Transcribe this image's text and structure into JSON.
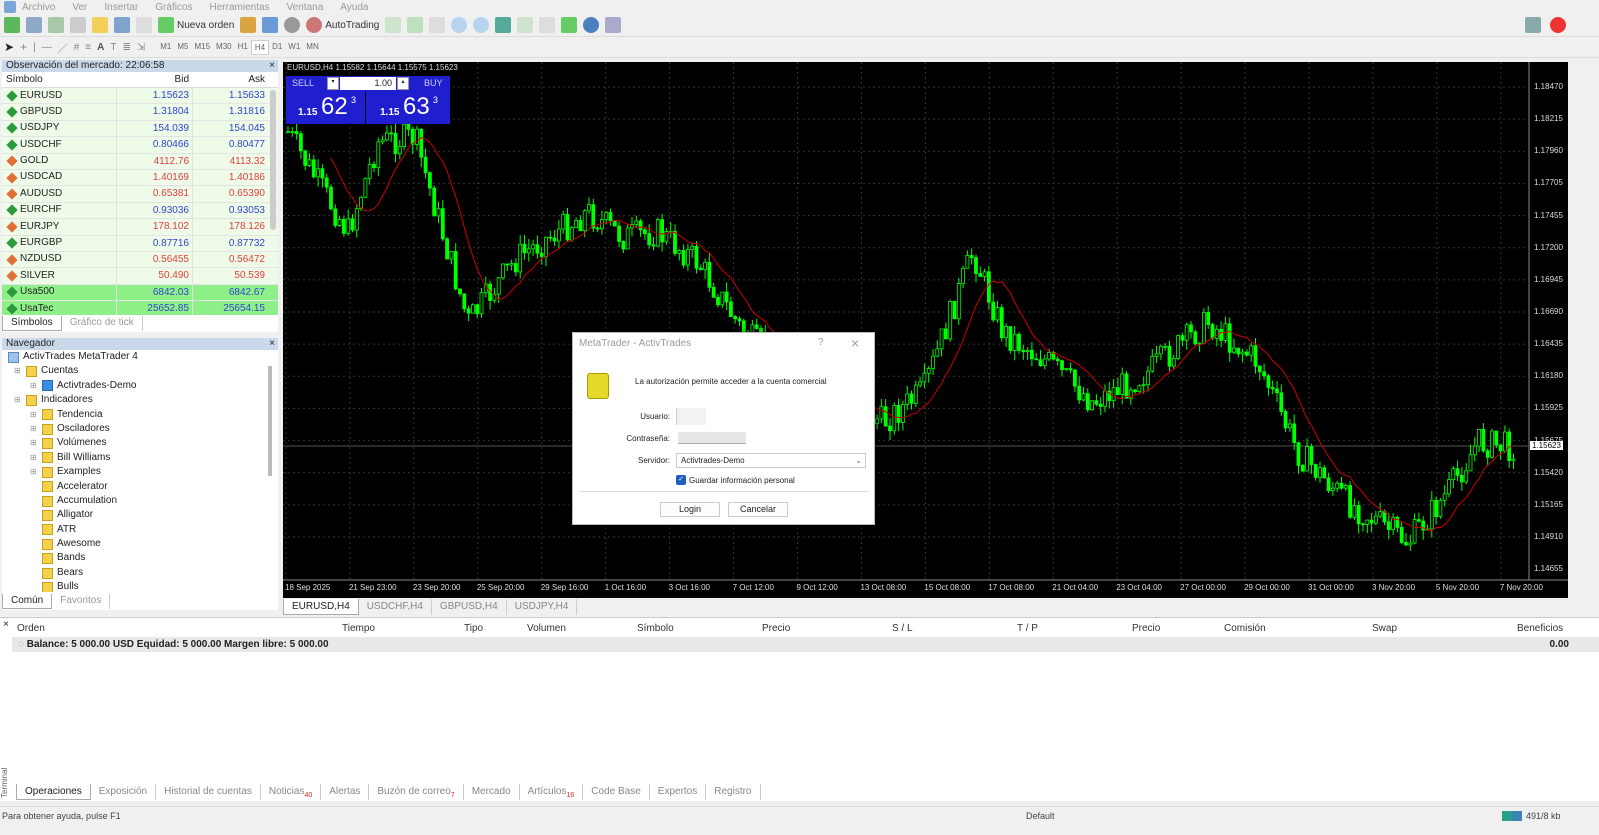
{
  "menu": [
    "Archivo",
    "Ver",
    "Insertar",
    "Gráficos",
    "Herramientas",
    "Ventana",
    "Ayuda"
  ],
  "toolbar": {
    "new_order": "Nueva orden",
    "autotrading": "AutoTrading",
    "timeframes": [
      "M1",
      "M5",
      "M15",
      "M30",
      "H1",
      "H4",
      "D1",
      "W1",
      "MN"
    ],
    "active_timeframe": "H4"
  },
  "market_watch": {
    "title": "Observación del mercado: 22:06:58",
    "columns": [
      "Símbolo",
      "Bid",
      "Ask"
    ],
    "rows": [
      {
        "symbol": "EURUSD",
        "bid": "1.15623",
        "ask": "1.15633",
        "dir": "up"
      },
      {
        "symbol": "GBPUSD",
        "bid": "1.31804",
        "ask": "1.31816",
        "dir": "up"
      },
      {
        "symbol": "USDJPY",
        "bid": "154.039",
        "ask": "154.045",
        "dir": "up"
      },
      {
        "symbol": "USDCHF",
        "bid": "0.80466",
        "ask": "0.80477",
        "dir": "up"
      },
      {
        "symbol": "GOLD",
        "bid": "4112.76",
        "ask": "4113.32",
        "dir": "dn"
      },
      {
        "symbol": "USDCAD",
        "bid": "1.40169",
        "ask": "1.40186",
        "dir": "dn"
      },
      {
        "symbol": "AUDUSD",
        "bid": "0.65381",
        "ask": "0.65390",
        "dir": "dn"
      },
      {
        "symbol": "EURCHF",
        "bid": "0.93036",
        "ask": "0.93053",
        "dir": "up"
      },
      {
        "symbol": "EURJPY",
        "bid": "178.102",
        "ask": "178.126",
        "dir": "dn"
      },
      {
        "symbol": "EURGBP",
        "bid": "0.87716",
        "ask": "0.87732",
        "dir": "up"
      },
      {
        "symbol": "NZDUSD",
        "bid": "0.56455",
        "ask": "0.56472",
        "dir": "dn"
      },
      {
        "symbol": "SILVER",
        "bid": "50.490",
        "ask": "50.539",
        "dir": "dn"
      },
      {
        "symbol": "Usa500",
        "bid": "6842.03",
        "ask": "6842.67",
        "dir": "up",
        "highlight": true
      },
      {
        "symbol": "UsaTec",
        "bid": "25652.85",
        "ask": "25654.15",
        "dir": "up",
        "highlight": true
      }
    ],
    "tabs": [
      "Símbolos",
      "Gráfico de tick"
    ]
  },
  "navigator": {
    "title": "Navegador",
    "root": "ActivTrades MetaTrader 4",
    "items": [
      {
        "label": "Cuentas",
        "level": 1
      },
      {
        "label": "Activtrades-Demo",
        "level": 2
      },
      {
        "label": "Indicadores",
        "level": 1
      },
      {
        "label": "Tendencia",
        "level": 2
      },
      {
        "label": "Osciladores",
        "level": 2
      },
      {
        "label": "Volúmenes",
        "level": 2
      },
      {
        "label": "Bill Williams",
        "level": 2
      },
      {
        "label": "Examples",
        "level": 2
      },
      {
        "label": "Accelerator",
        "level": 2
      },
      {
        "label": "Accumulation",
        "level": 2
      },
      {
        "label": "Alligator",
        "level": 2
      },
      {
        "label": "ATR",
        "level": 2
      },
      {
        "label": "Awesome",
        "level": 2
      },
      {
        "label": "Bands",
        "level": 2
      },
      {
        "label": "Bears",
        "level": 2
      },
      {
        "label": "Bulls",
        "level": 2
      }
    ],
    "tabs": [
      "Común",
      "Favoritos"
    ]
  },
  "chart": {
    "header": "EURUSD,H4  1.15582 1.15644 1.15575 1.15623",
    "one_click": {
      "sell": "SELL",
      "buy": "BUY",
      "lot": "1.00",
      "sell_prefix": "1.15",
      "sell_big": "62",
      "sell_sup": "3",
      "buy_prefix": "1.15",
      "buy_big": "63",
      "buy_sup": "3"
    },
    "price_ticks": [
      "1.18470",
      "1.18215",
      "1.17960",
      "1.17705",
      "1.17455",
      "1.17200",
      "1.16945",
      "1.16690",
      "1.16435",
      "1.16180",
      "1.15925",
      "1.15675",
      "1.15420",
      "1.15165",
      "1.14910",
      "1.14655"
    ],
    "current_price": "1.15623",
    "time_ticks": [
      "18 Sep 2025",
      "21 Sep 23:00",
      "23 Sep 20:00",
      "25 Sep 20:00",
      "29 Sep 16:00",
      "1 Oct 16:00",
      "3 Oct 16:00",
      "7 Oct 12:00",
      "9 Oct 12:00",
      "13 Oct 08:00",
      "15 Oct 08:00",
      "17 Oct 08:00",
      "21 Oct 04:00",
      "23 Oct 04:00",
      "27 Oct 00:00",
      "29 Oct 00:00",
      "31 Oct 00:00",
      "3 Nov 20:00",
      "5 Nov 20:00",
      "7 Nov 20:00"
    ],
    "colors": {
      "bull": "#00ff00",
      "bear": "#00ff00",
      "ma": "#cc0000",
      "background": "#000000"
    },
    "tabs": [
      "EURUSD,H4",
      "USDCHF,H4",
      "GBPUSD,H4",
      "USDJPY,H4"
    ]
  },
  "dialog": {
    "title": "MetaTrader - ActivTrades",
    "help": "?",
    "message": "La autorización permite acceder a la cuenta comercial",
    "user_label": "Usuario:",
    "user_value": "",
    "password_label": "Contraseña:",
    "password_value": "",
    "server_label": "Servidor:",
    "server_value": "Activtrades-Demo",
    "save_label": "Guardar información personal",
    "save_checked": true,
    "login": "Login",
    "cancel": "Cancelar"
  },
  "terminal": {
    "columns": [
      "Orden",
      "Tiempo",
      "Tipo",
      "Volumen",
      "Símbolo",
      "Precio",
      "S / L",
      "T / P",
      "Precio",
      "Comisión",
      "Swap",
      "Beneficios"
    ],
    "balance": "Balance: 5 000.00 USD  Equidad: 5 000.00  Margen libre: 5 000.00",
    "profit": "0.00",
    "side_label": "Terminal",
    "tabs": [
      {
        "label": "Operaciones"
      },
      {
        "label": "Exposición"
      },
      {
        "label": "Historial de cuentas"
      },
      {
        "label": "Noticias",
        "badge": "40"
      },
      {
        "label": "Alertas"
      },
      {
        "label": "Buzón de correo",
        "badge": "7"
      },
      {
        "label": "Mercado"
      },
      {
        "label": "Artículos",
        "badge": "16"
      },
      {
        "label": "Code Base"
      },
      {
        "label": "Expertos"
      },
      {
        "label": "Registro"
      }
    ]
  },
  "status": {
    "help": "Para obtener ayuda, pulse F1",
    "profile": "Default",
    "traffic": "491/8 kb"
  }
}
